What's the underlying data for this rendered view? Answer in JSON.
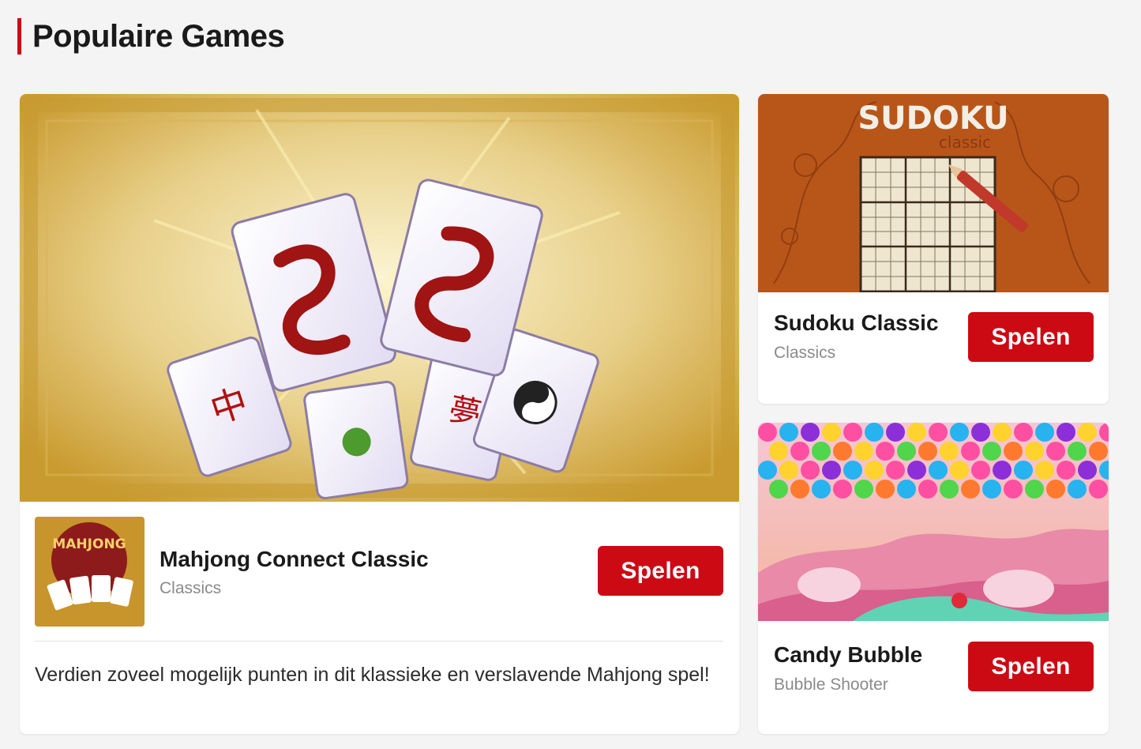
{
  "section": {
    "title": "Populaire Games"
  },
  "colors": {
    "accent": "#cc0a14",
    "background": "#f4f4f4"
  },
  "featured": {
    "image_alt": "mahjong-tiles-artwork",
    "icon_name": "mahjong-connect-logo-icon",
    "icon_text": "MAHJONG",
    "title": "Mahjong Connect Classic",
    "category": "Classics",
    "button_label": "Spelen",
    "description": "Verdien zoveel mogelijk punten in dit klassieke en verslavende Mahjong spel!"
  },
  "games": [
    {
      "thumb_heading": "SUDOKU",
      "thumb_sub": "classic",
      "title": "Sudoku Classic",
      "category": "Classics",
      "button_label": "Spelen"
    },
    {
      "title": "Candy Bubble",
      "category": "Bubble Shooter",
      "button_label": "Spelen"
    }
  ]
}
